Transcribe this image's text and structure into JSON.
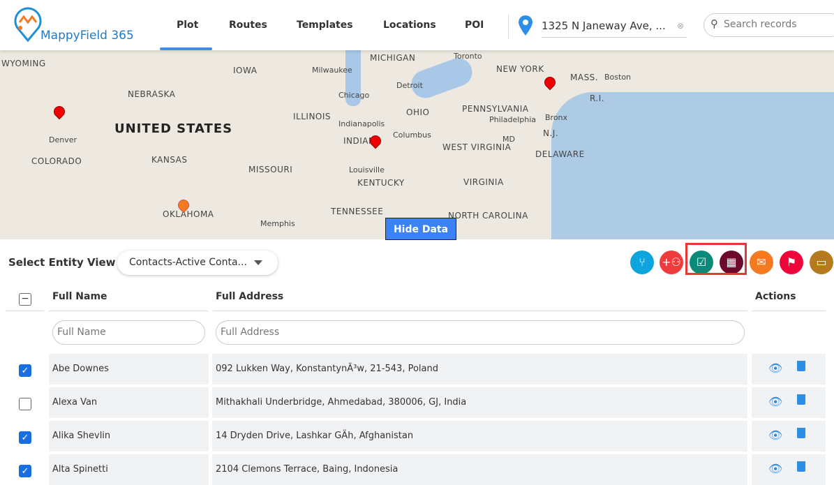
{
  "header": {
    "brand": "MappyField 365",
    "tabs": [
      "Plot",
      "Routes",
      "Templates",
      "Locations",
      "POI"
    ],
    "active_tab": "Plot",
    "address": "1325 N Janeway Ave, ...",
    "search_placeholder": "Search records"
  },
  "map": {
    "labels": [
      "WYOMING",
      "IOWA",
      "MICHIGAN",
      "Toronto",
      "NEW YORK",
      "MASS.",
      "Boston",
      "Milwaukee",
      "Detroit",
      "NEBRASKA",
      "Chicago",
      "R.I.",
      "PENNSYLVANIA",
      "ILLINOIS",
      "OHIO",
      "Philadelphia",
      "Denver",
      "Indianapolis",
      "Bronx",
      "Columbus",
      "N.J.",
      "INDIANA",
      "MD",
      "WEST VIRGINIA",
      "DELAWARE",
      "COLORADO",
      "KANSAS",
      "MISSOURI",
      "Louisville",
      "KENTUCKY",
      "VIRGINIA",
      "OKLAHOMA",
      "TENNESSEE",
      "Memphis",
      "NORTH CAROLINA"
    ],
    "country": "UNITED STATES",
    "hide_button": "Hide Data"
  },
  "toolbar": {
    "entity_label": "Select Entity View",
    "entity_value": "Contacts-Active Conta...",
    "actions": [
      {
        "icon": "route-split-icon",
        "color": "#0ea5dc"
      },
      {
        "icon": "add-group-icon",
        "color": "#ef3b3b"
      },
      {
        "icon": "calendar-check-icon",
        "color": "#0a8a78"
      },
      {
        "icon": "calendar-grid-icon",
        "color": "#6d0a2a"
      },
      {
        "icon": "mail-icon",
        "color": "#f47a20"
      },
      {
        "icon": "flag-icon",
        "color": "#f0053a"
      },
      {
        "icon": "calendar-icon",
        "color": "#b57a1f"
      }
    ]
  },
  "table": {
    "headers": {
      "name": "Full Name",
      "address": "Full Address",
      "actions": "Actions"
    },
    "filters": {
      "name": "Full Name",
      "address": "Full Address"
    },
    "rows": [
      {
        "name": "Abe Downes",
        "address": "092 Lukken Way, KonstantynÃ³w, 21-543, Poland",
        "checked": true
      },
      {
        "name": "Alexa Van",
        "address": "Mithakhali Underbridge, Ahmedabad, 380006, GJ, India",
        "checked": false
      },
      {
        "name": "Alika Shevlin",
        "address": "14 Dryden Drive, Lashkar GÄh, Afghanistan",
        "checked": true
      },
      {
        "name": "Alta Spinetti",
        "address": "2104 Clemons Terrace, Baing, Indonesia",
        "checked": true
      }
    ]
  }
}
